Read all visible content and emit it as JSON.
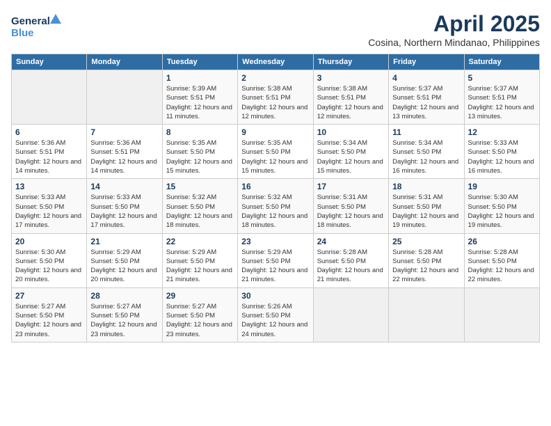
{
  "header": {
    "logo_general": "General",
    "logo_blue": "Blue",
    "month_year": "April 2025",
    "location": "Cosina, Northern Mindanao, Philippines"
  },
  "days_of_week": [
    "Sunday",
    "Monday",
    "Tuesday",
    "Wednesday",
    "Thursday",
    "Friday",
    "Saturday"
  ],
  "weeks": [
    [
      {
        "day": "",
        "info": ""
      },
      {
        "day": "",
        "info": ""
      },
      {
        "day": "1",
        "info": "Sunrise: 5:39 AM\nSunset: 5:51 PM\nDaylight: 12 hours and 11 minutes."
      },
      {
        "day": "2",
        "info": "Sunrise: 5:38 AM\nSunset: 5:51 PM\nDaylight: 12 hours and 12 minutes."
      },
      {
        "day": "3",
        "info": "Sunrise: 5:38 AM\nSunset: 5:51 PM\nDaylight: 12 hours and 12 minutes."
      },
      {
        "day": "4",
        "info": "Sunrise: 5:37 AM\nSunset: 5:51 PM\nDaylight: 12 hours and 13 minutes."
      },
      {
        "day": "5",
        "info": "Sunrise: 5:37 AM\nSunset: 5:51 PM\nDaylight: 12 hours and 13 minutes."
      }
    ],
    [
      {
        "day": "6",
        "info": "Sunrise: 5:36 AM\nSunset: 5:51 PM\nDaylight: 12 hours and 14 minutes."
      },
      {
        "day": "7",
        "info": "Sunrise: 5:36 AM\nSunset: 5:51 PM\nDaylight: 12 hours and 14 minutes."
      },
      {
        "day": "8",
        "info": "Sunrise: 5:35 AM\nSunset: 5:50 PM\nDaylight: 12 hours and 15 minutes."
      },
      {
        "day": "9",
        "info": "Sunrise: 5:35 AM\nSunset: 5:50 PM\nDaylight: 12 hours and 15 minutes."
      },
      {
        "day": "10",
        "info": "Sunrise: 5:34 AM\nSunset: 5:50 PM\nDaylight: 12 hours and 15 minutes."
      },
      {
        "day": "11",
        "info": "Sunrise: 5:34 AM\nSunset: 5:50 PM\nDaylight: 12 hours and 16 minutes."
      },
      {
        "day": "12",
        "info": "Sunrise: 5:33 AM\nSunset: 5:50 PM\nDaylight: 12 hours and 16 minutes."
      }
    ],
    [
      {
        "day": "13",
        "info": "Sunrise: 5:33 AM\nSunset: 5:50 PM\nDaylight: 12 hours and 17 minutes."
      },
      {
        "day": "14",
        "info": "Sunrise: 5:33 AM\nSunset: 5:50 PM\nDaylight: 12 hours and 17 minutes."
      },
      {
        "day": "15",
        "info": "Sunrise: 5:32 AM\nSunset: 5:50 PM\nDaylight: 12 hours and 18 minutes."
      },
      {
        "day": "16",
        "info": "Sunrise: 5:32 AM\nSunset: 5:50 PM\nDaylight: 12 hours and 18 minutes."
      },
      {
        "day": "17",
        "info": "Sunrise: 5:31 AM\nSunset: 5:50 PM\nDaylight: 12 hours and 18 minutes."
      },
      {
        "day": "18",
        "info": "Sunrise: 5:31 AM\nSunset: 5:50 PM\nDaylight: 12 hours and 19 minutes."
      },
      {
        "day": "19",
        "info": "Sunrise: 5:30 AM\nSunset: 5:50 PM\nDaylight: 12 hours and 19 minutes."
      }
    ],
    [
      {
        "day": "20",
        "info": "Sunrise: 5:30 AM\nSunset: 5:50 PM\nDaylight: 12 hours and 20 minutes."
      },
      {
        "day": "21",
        "info": "Sunrise: 5:29 AM\nSunset: 5:50 PM\nDaylight: 12 hours and 20 minutes."
      },
      {
        "day": "22",
        "info": "Sunrise: 5:29 AM\nSunset: 5:50 PM\nDaylight: 12 hours and 21 minutes."
      },
      {
        "day": "23",
        "info": "Sunrise: 5:29 AM\nSunset: 5:50 PM\nDaylight: 12 hours and 21 minutes."
      },
      {
        "day": "24",
        "info": "Sunrise: 5:28 AM\nSunset: 5:50 PM\nDaylight: 12 hours and 21 minutes."
      },
      {
        "day": "25",
        "info": "Sunrise: 5:28 AM\nSunset: 5:50 PM\nDaylight: 12 hours and 22 minutes."
      },
      {
        "day": "26",
        "info": "Sunrise: 5:28 AM\nSunset: 5:50 PM\nDaylight: 12 hours and 22 minutes."
      }
    ],
    [
      {
        "day": "27",
        "info": "Sunrise: 5:27 AM\nSunset: 5:50 PM\nDaylight: 12 hours and 23 minutes."
      },
      {
        "day": "28",
        "info": "Sunrise: 5:27 AM\nSunset: 5:50 PM\nDaylight: 12 hours and 23 minutes."
      },
      {
        "day": "29",
        "info": "Sunrise: 5:27 AM\nSunset: 5:50 PM\nDaylight: 12 hours and 23 minutes."
      },
      {
        "day": "30",
        "info": "Sunrise: 5:26 AM\nSunset: 5:50 PM\nDaylight: 12 hours and 24 minutes."
      },
      {
        "day": "",
        "info": ""
      },
      {
        "day": "",
        "info": ""
      },
      {
        "day": "",
        "info": ""
      }
    ]
  ]
}
